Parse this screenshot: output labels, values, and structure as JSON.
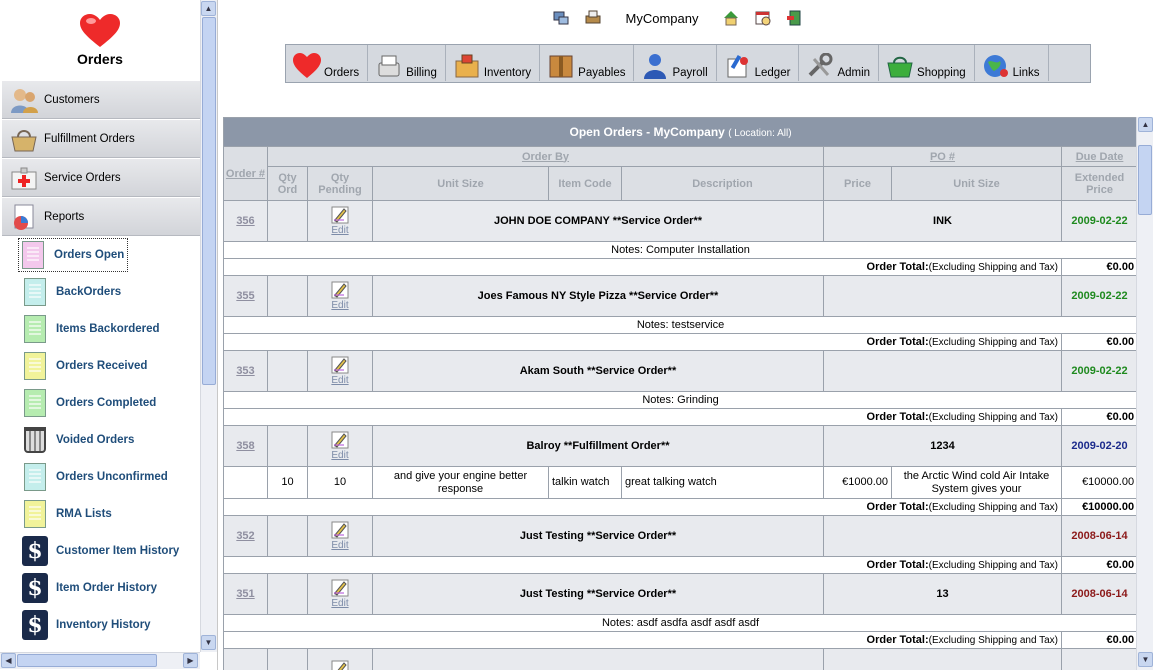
{
  "sidebar": {
    "title": "Orders",
    "modules": [
      {
        "label": "Customers",
        "icon": "customers-icon"
      },
      {
        "label": "Fulfillment Orders",
        "icon": "basket-icon"
      },
      {
        "label": "Service Orders",
        "icon": "first-aid-icon"
      },
      {
        "label": "Reports",
        "icon": "report-chart-icon"
      }
    ],
    "reports": [
      {
        "label": "Orders Open",
        "icon": "pink-doc-icon",
        "color": "#f3c8ec"
      },
      {
        "label": "BackOrders",
        "icon": "teal-doc-icon",
        "color": "#c4eeec"
      },
      {
        "label": "Items Backordered",
        "icon": "green-doc-icon",
        "color": "#b6ecb0"
      },
      {
        "label": "Orders Received",
        "icon": "yellow-doc-icon",
        "color": "#f1f39a"
      },
      {
        "label": "Orders Completed",
        "icon": "green-doc-icon",
        "color": "#b6ecb0"
      },
      {
        "label": "Voided Orders",
        "icon": "trash-icon",
        "color": "#dddddd"
      },
      {
        "label": "Orders Unconfirmed",
        "icon": "teal-doc-icon",
        "color": "#c4eeec"
      },
      {
        "label": "RMA Lists",
        "icon": "yellow-doc-icon",
        "color": "#f1f39a"
      },
      {
        "label": "Customer Item History",
        "icon": "dollar-icon",
        "color": "#1a2a4a"
      },
      {
        "label": "Item Order History",
        "icon": "dollar-icon",
        "color": "#1a2a4a"
      },
      {
        "label": "Inventory History",
        "icon": "dollar-icon",
        "color": "#1a2a4a"
      }
    ]
  },
  "topbar": {
    "company": "MyCompany",
    "icons": [
      "network-icon",
      "printer-icon",
      "home-icon",
      "calendar-clock-icon",
      "logout-door-icon"
    ]
  },
  "nav": [
    {
      "label": "Orders",
      "icon": "heart-icon"
    },
    {
      "label": "Billing",
      "icon": "billing-icon"
    },
    {
      "label": "Inventory",
      "icon": "inventory-box-icon"
    },
    {
      "label": "Payables",
      "icon": "payables-book-icon"
    },
    {
      "label": "Payroll",
      "icon": "payroll-person-icon"
    },
    {
      "label": "Ledger",
      "icon": "ledger-icon"
    },
    {
      "label": "Admin",
      "icon": "admin-tools-icon"
    },
    {
      "label": "Shopping",
      "icon": "shopping-basket-icon"
    },
    {
      "label": "Links",
      "icon": "globe-icon"
    }
  ],
  "table": {
    "title": "Open Orders - MyCompany",
    "location": "( Location: All)",
    "headers": {
      "order_num": "Order #",
      "order_by": "Order By",
      "po_num": "PO #",
      "due_date": "Due Date",
      "qty_ord": "Qty Ord",
      "qty_pending": "Qty Pending",
      "unit_size": "Unit Size",
      "item_code": "Item Code",
      "description": "Description",
      "price": "Price",
      "unit_size2": "Unit Size",
      "extended_price": "Extended Price"
    },
    "edit_label": "Edit",
    "notes_prefix": "Notes: ",
    "total_label": "Order Total:",
    "total_note": "(Excluding Shipping and Tax)",
    "orders": [
      {
        "num": "356",
        "name": "JOHN DOE COMPANY **Service Order**",
        "po": "INK",
        "due": "2009-02-22",
        "due_color": "green",
        "notes": "Notes: Computer Installation",
        "total": "€0.00"
      },
      {
        "num": "355",
        "name": "Joes Famous NY Style Pizza **Service Order**",
        "po": "",
        "due": "2009-02-22",
        "due_color": "green",
        "notes": "Notes: testservice",
        "total": "€0.00"
      },
      {
        "num": "353",
        "name": "Akam South **Service Order**",
        "po": "",
        "due": "2009-02-22",
        "due_color": "green",
        "notes": "Notes: Grinding",
        "total": "€0.00"
      },
      {
        "num": "358",
        "name": "Balroy **Fulfillment Order**",
        "po": "1234",
        "due": "2009-02-20",
        "due_color": "navy",
        "item": {
          "qty_ord": "10",
          "qty_pending": "10",
          "unit_size": "and give your engine better response",
          "item_code": "talkin watch",
          "description": "great talking watch",
          "price": "€1000.00",
          "unit_size2": "the Arctic Wind cold Air Intake System gives your",
          "extended": "€10000.00"
        },
        "total": "€10000.00"
      },
      {
        "num": "352",
        "name": "Just Testing **Service Order**",
        "po": "",
        "due": "2008-06-14",
        "due_color": "maroon",
        "total": "€0.00"
      },
      {
        "num": "351",
        "name": "Just Testing **Service Order**",
        "po": "13",
        "due": "2008-06-14",
        "due_color": "maroon",
        "notes": "Notes: asdf asdfa asdf asdf asdf",
        "total": "€0.00"
      }
    ]
  },
  "colors": {
    "header": "#8c97a8",
    "row": "#e8eaee",
    "green": "#1f8a1f",
    "navy": "#1c2b8c",
    "maroon": "#8c1a1a"
  }
}
